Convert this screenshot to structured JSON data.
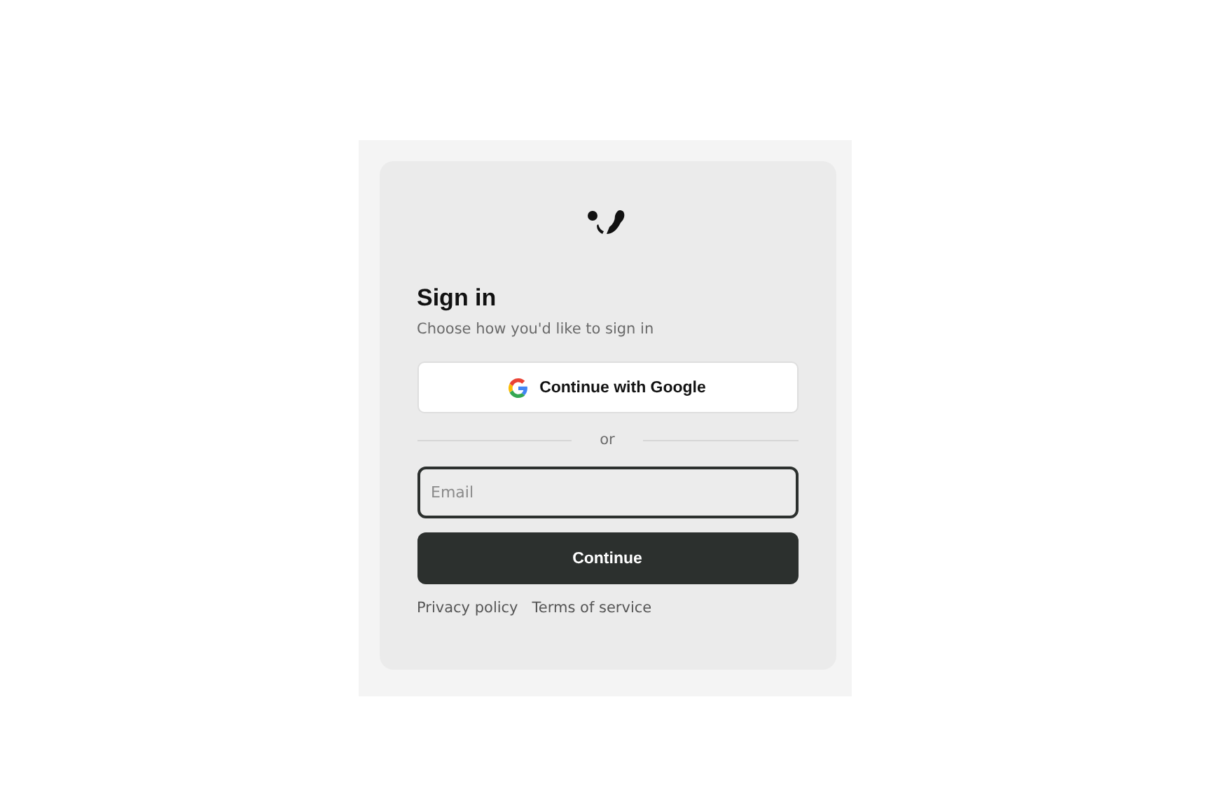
{
  "title": "Sign in",
  "subtitle": "Choose how you'd like to sign in",
  "google_button": {
    "label": "Continue with Google"
  },
  "divider": {
    "label": "or"
  },
  "email": {
    "placeholder": "Email",
    "focused": true
  },
  "continue_button": {
    "label": "Continue"
  },
  "links": [
    "Privacy policy",
    "Terms of service"
  ]
}
